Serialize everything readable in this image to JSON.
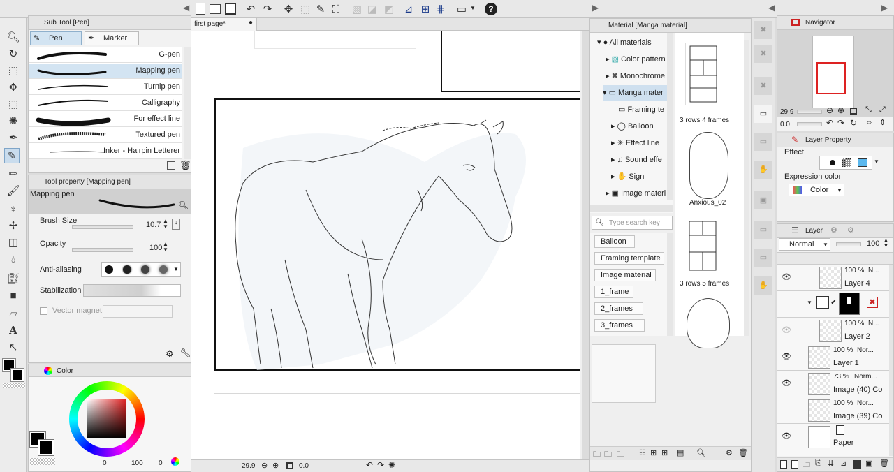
{
  "toolbar": {
    "icons": [
      "new-file-icon",
      "open-icon",
      "save-icon",
      "undo-icon",
      "redo-icon",
      "transform-icon",
      "selection-icon",
      "lasso-icon",
      "crop-icon",
      "clear-icon",
      "fill-icon",
      "invert-icon",
      "ruler-icon",
      "grid-icon",
      "frame-icon",
      "help-icon"
    ]
  },
  "subtool": {
    "title": "Sub Tool [Pen]",
    "tabs": [
      "Pen",
      "Marker"
    ],
    "brushes": [
      "G-pen",
      "Mapping pen",
      "Turnip pen",
      "Calligraphy",
      "For effect line",
      "Textured pen",
      "Inker - Hairpin Letterer"
    ]
  },
  "tool_property": {
    "title": "Tool property [Mapping pen]",
    "preset": "Mapping pen",
    "brush_size_label": "Brush Size",
    "brush_size": "10.7",
    "opacity_label": "Opacity",
    "opacity": "100",
    "anti_aliasing_label": "Anti-aliasing",
    "stabilization_label": "Stabilization",
    "vector_magnet_label": "Vector magnet"
  },
  "color": {
    "tab": "Color",
    "values": [
      "0",
      "100",
      "0"
    ]
  },
  "canvas": {
    "tab": "first page*",
    "zoom": "29.9",
    "rotation": "0.0"
  },
  "material": {
    "title": "Material [Manga material]",
    "tree": [
      "All materials",
      "Color pattern",
      "Monochrome",
      "Manga mater",
      "Framing te",
      "Balloon",
      "Effect line",
      "Sound effe",
      "Sign",
      "Image materi"
    ],
    "items": [
      "3 rows 4 frames",
      "Anxious_02",
      "3 rows 5 frames"
    ],
    "search_placeholder": "Type search key",
    "tags": [
      "Balloon",
      "Framing template",
      "Image material",
      "1_frame",
      "2_frames",
      "3_frames"
    ]
  },
  "navigator": {
    "title": "Navigator",
    "zoom": "29.9",
    "rotation": "0.0"
  },
  "layer_property": {
    "title": "Layer Property",
    "effect_label": "Effect",
    "expression_color_label": "Expression color",
    "expression_color": "Color"
  },
  "layers": {
    "title": "Layer",
    "blend_mode": "Normal",
    "opacity": "100",
    "rows": [
      {
        "pct": "100 %",
        "mode": "N...",
        "name": "Layer 4"
      },
      {
        "pct": "",
        "mode": "",
        "name": ""
      },
      {
        "pct": "100 %",
        "mode": "N...",
        "name": "Layer 2"
      },
      {
        "pct": "100 %",
        "mode": "Nor...",
        "name": "Layer 1"
      },
      {
        "pct": "73 %",
        "mode": "Norm...",
        "name": "Image (40) Co"
      },
      {
        "pct": "100 %",
        "mode": "Nor...",
        "name": "Image (39) Co"
      },
      {
        "pct": "",
        "mode": "",
        "name": "Paper"
      }
    ]
  }
}
